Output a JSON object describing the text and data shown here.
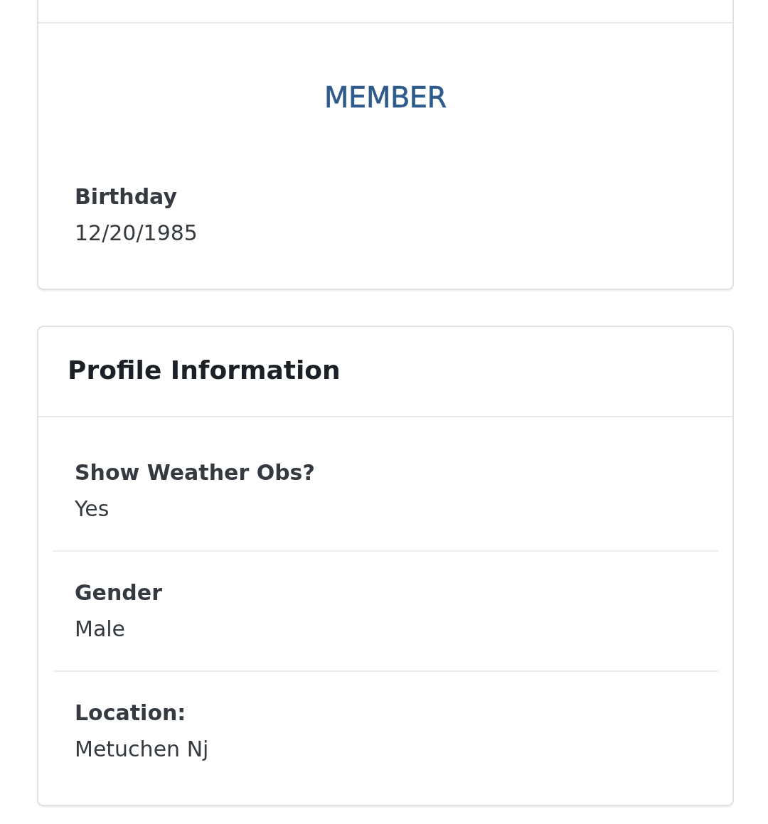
{
  "member_card": {
    "badge": "MEMBER",
    "fields": [
      {
        "label": "Birthday",
        "value": "12/20/1985"
      }
    ]
  },
  "profile_card": {
    "title": "Profile Information",
    "fields": [
      {
        "label": "Show Weather Obs?",
        "value": "Yes"
      },
      {
        "label": "Gender",
        "value": "Male"
      },
      {
        "label": "Location:",
        "value": "Metuchen Nj"
      }
    ]
  }
}
